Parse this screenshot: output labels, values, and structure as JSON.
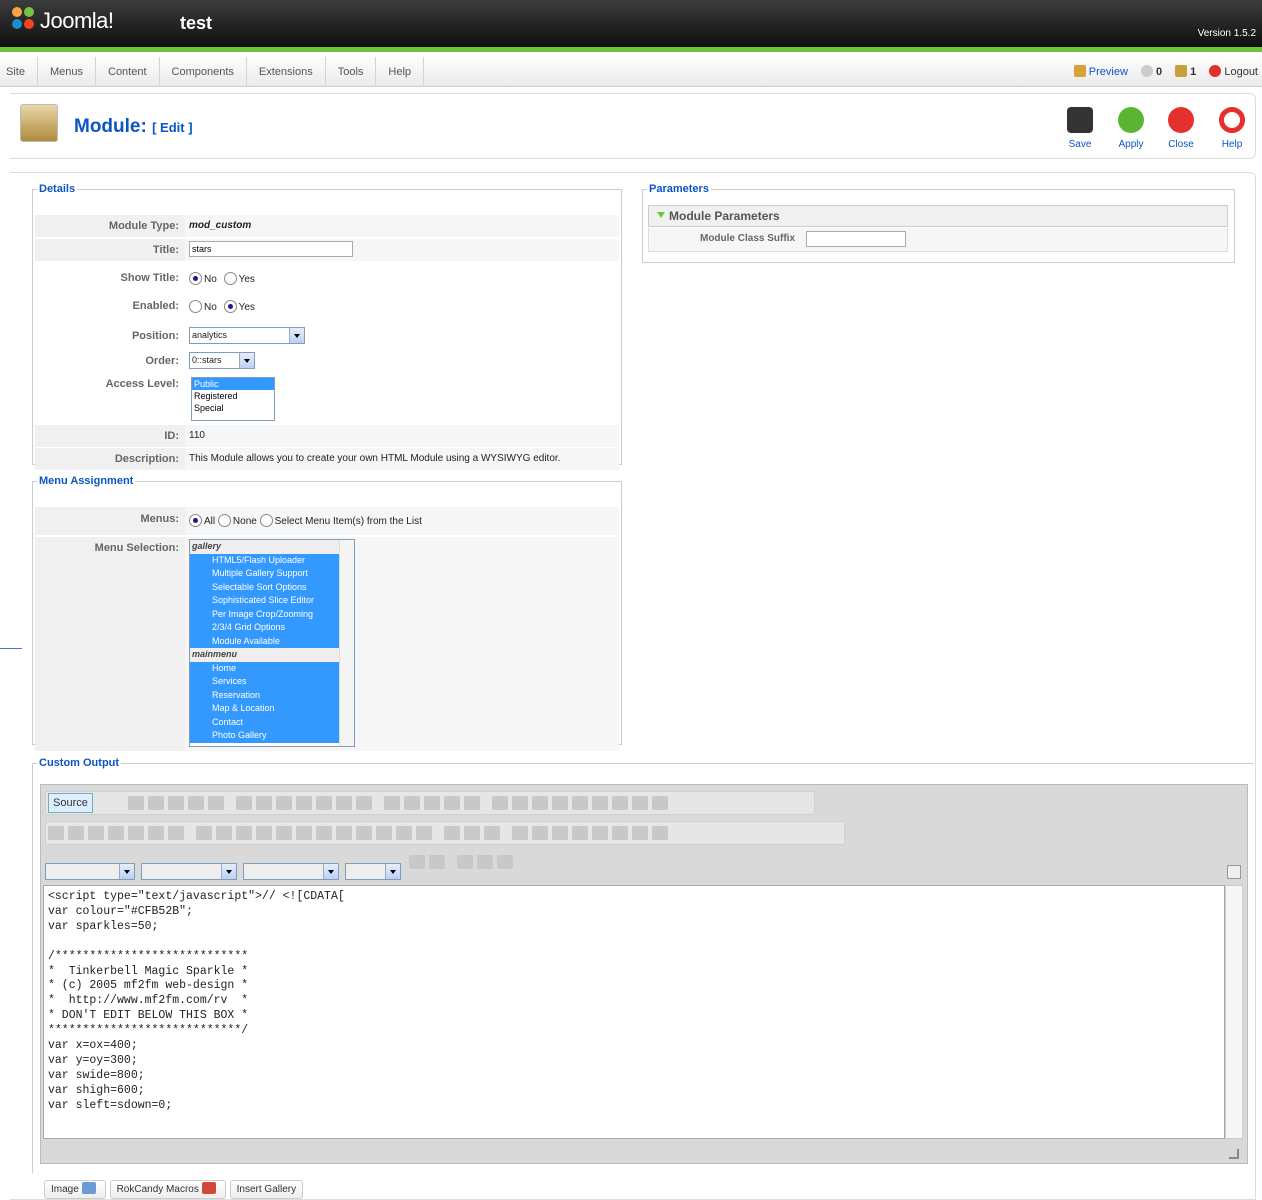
{
  "header": {
    "logo_text": "Joomla!",
    "site_name": "test",
    "version": "Version 1.5.2"
  },
  "menu": {
    "items": [
      "Site",
      "Menus",
      "Content",
      "Components",
      "Extensions",
      "Tools",
      "Help"
    ],
    "preview": "Preview",
    "messages": "0",
    "users": "1",
    "logout": "Logout"
  },
  "toolbar": {
    "title": "Module:",
    "subtitle": "[ Edit ]",
    "save": "Save",
    "apply": "Apply",
    "close": "Close",
    "help": "Help"
  },
  "details": {
    "legend": "Details",
    "module_type_label": "Module Type:",
    "module_type": "mod_custom",
    "title_label": "Title:",
    "title_value": "stars",
    "show_title_label": "Show Title:",
    "no": "No",
    "yes": "Yes",
    "enabled_label": "Enabled:",
    "position_label": "Position:",
    "position_value": "analytics",
    "order_label": "Order:",
    "order_value": "0::stars",
    "access_label": "Access Level:",
    "access_options": [
      "Public",
      "Registered",
      "Special"
    ],
    "id_label": "ID:",
    "id_value": "110",
    "description_label": "Description:",
    "description": "This Module allows you to create your own HTML Module using a WYSIWYG editor."
  },
  "menu_assignment": {
    "legend": "Menu Assignment",
    "menus_label": "Menus:",
    "all": "All",
    "none": "None",
    "select": "Select Menu Item(s) from the List",
    "selection_label": "Menu Selection:",
    "groups": [
      {
        "name": "gallery",
        "items": [
          "HTML5/Flash Uploader",
          "Multiple Gallery Support",
          "Selectable Sort Options",
          "Sophisticated Slice Editor",
          "Per Image Crop/Zooming",
          "2/3/4 Grid Options",
          "Module Available"
        ]
      },
      {
        "name": "mainmenu",
        "items": [
          "Home",
          "Services",
          "Reservation",
          "Map & Location",
          "Contact",
          "Photo Gallery"
        ]
      }
    ]
  },
  "parameters": {
    "legend": "Parameters",
    "section": "Module Parameters",
    "class_suffix_label": "Module Class Suffix"
  },
  "custom_output": {
    "legend": "Custom Output",
    "source_label": "Source",
    "code": "<script type=\"text/javascript\">// <![CDATA[\nvar colour=\"#CFB52B\";\nvar sparkles=50;\n\n/****************************\n*  Tinkerbell Magic Sparkle *\n* (c) 2005 mf2fm web-design *\n*  http://www.mf2fm.com/rv  *\n* DON'T EDIT BELOW THIS BOX *\n****************************/\nvar x=ox=400;\nvar y=oy=300;\nvar swide=800;\nvar shigh=600;\nvar sleft=sdown=0;"
  },
  "bottom_buttons": [
    "Image",
    "RokCandy Macros",
    "Insert Gallery"
  ]
}
